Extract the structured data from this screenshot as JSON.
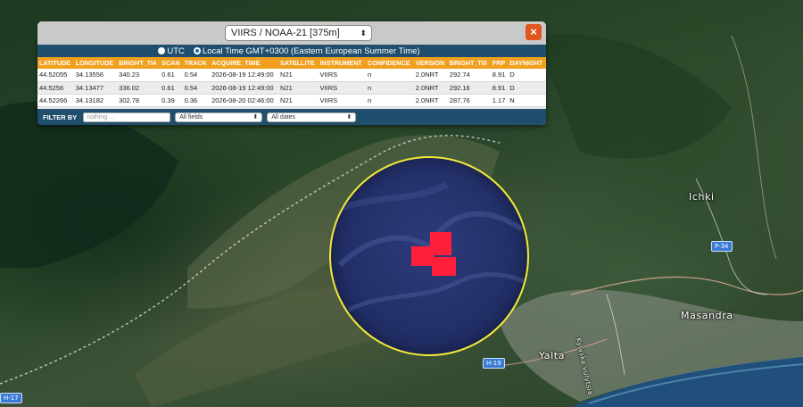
{
  "popup": {
    "source_select": "VIIRS / NOAA-21 [375m]",
    "timezone": {
      "utc_label": "UTC",
      "local_label": "Local Time GMT+0300 (Eastern European Summer Time)",
      "selected": "local"
    },
    "table": {
      "columns": [
        "LATITUDE",
        "LONGITUDE",
        "BRIGHT_TI4",
        "SCAN",
        "TRACK",
        "ACQUIRE_TIME",
        "SATELLITE",
        "INSTRUMENT",
        "CONFIDENCE",
        "VERSION",
        "BRIGHT_TI5",
        "FRP",
        "DAYNIGHT"
      ],
      "rows": [
        [
          "44.52055",
          "34.13556",
          "340.23",
          "0.61",
          "0.54",
          "2026-08-19 12:49:00",
          "N21",
          "VIIRS",
          "n",
          "2.0NRT",
          "292.74",
          "8.91",
          "D"
        ],
        [
          "44.5256",
          "34.13477",
          "336.02",
          "0.61",
          "0.54",
          "2026-08-19 12:49:00",
          "N21",
          "VIIRS",
          "n",
          "2.0NRT",
          "292.16",
          "8.91",
          "D"
        ],
        [
          "44.52266",
          "34.13182",
          "302.78",
          "0.39",
          "0.36",
          "2026-08-20 02:46:00",
          "N21",
          "VIIRS",
          "n",
          "2.0NRT",
          "287.76",
          "1.17",
          "N"
        ]
      ]
    },
    "filter": {
      "label": "FILTER BY",
      "placeholder": "nothing ...",
      "field_select": "All fields",
      "date_select": "All dates"
    }
  },
  "map": {
    "places": {
      "ichki": "Ichki",
      "masandra": "Masandra",
      "yalta": "Yalta"
    },
    "roads": {
      "p34": "P-34",
      "h19": "H-19",
      "h17": "H-17"
    },
    "street": "Kyivska vulytsia",
    "colors": {
      "focus_circle": "#f2e93a",
      "fire_pixel": "#ff1f3a",
      "sea": "#1f4f7a"
    }
  }
}
